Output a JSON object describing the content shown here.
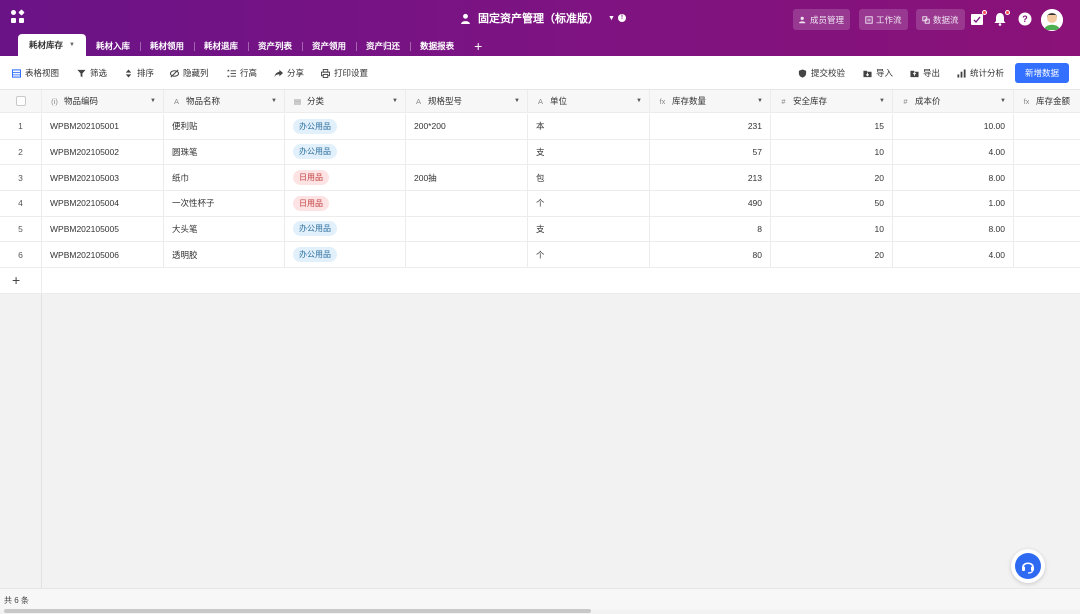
{
  "header": {
    "title": "固定资产管理（标准版）",
    "buttons": {
      "members": "成员管理",
      "workflow": "工作流",
      "dataflow": "数据流"
    },
    "help_glyph": "?"
  },
  "tabs": [
    {
      "label": "耗材库存",
      "active": true
    },
    {
      "label": "耗材入库"
    },
    {
      "label": "耗材领用"
    },
    {
      "label": "耗材退库"
    },
    {
      "label": "资产列表"
    },
    {
      "label": "资产领用"
    },
    {
      "label": "资产归还"
    },
    {
      "label": "数据报表"
    }
  ],
  "tab_add": "+",
  "toolbar": {
    "table_view": "表格视图",
    "filter": "筛选",
    "sort": "排序",
    "hide_cols": "隐藏列",
    "row_height": "行高",
    "share": "分享",
    "print": "打印设置",
    "submit_check": "提交校验",
    "import": "导入",
    "export": "导出",
    "stats": "统计分析",
    "new_data": "新增数据"
  },
  "columns": [
    {
      "label": "物品编码",
      "icon": "(i)"
    },
    {
      "label": "物品名称",
      "icon": "A"
    },
    {
      "label": "分类",
      "icon": "▤"
    },
    {
      "label": "规格型号",
      "icon": "A"
    },
    {
      "label": "单位",
      "icon": "A"
    },
    {
      "label": "库存数量",
      "icon": "fx"
    },
    {
      "label": "安全库存",
      "icon": "#"
    },
    {
      "label": "成本价",
      "icon": "#"
    },
    {
      "label": "库存金额",
      "icon": "fx"
    }
  ],
  "rows": [
    {
      "n": "1",
      "code": "WPBM202105001",
      "name": "便利贴",
      "cat": "办公用品",
      "cat_type": "office",
      "spec": "200*200",
      "unit": "本",
      "qty": "231",
      "safe": "15",
      "cost": "10.00"
    },
    {
      "n": "2",
      "code": "WPBM202105002",
      "name": "圆珠笔",
      "cat": "办公用品",
      "cat_type": "office",
      "spec": "",
      "unit": "支",
      "qty": "57",
      "safe": "10",
      "cost": "4.00"
    },
    {
      "n": "3",
      "code": "WPBM202105003",
      "name": "纸巾",
      "cat": "日用品",
      "cat_type": "daily",
      "spec": "200抽",
      "unit": "包",
      "qty": "213",
      "safe": "20",
      "cost": "8.00"
    },
    {
      "n": "4",
      "code": "WPBM202105004",
      "name": "一次性杯子",
      "cat": "日用品",
      "cat_type": "daily",
      "spec": "",
      "unit": "个",
      "qty": "490",
      "safe": "50",
      "cost": "1.00"
    },
    {
      "n": "5",
      "code": "WPBM202105005",
      "name": "大头笔",
      "cat": "办公用品",
      "cat_type": "office",
      "spec": "",
      "unit": "支",
      "qty": "8",
      "safe": "10",
      "cost": "8.00"
    },
    {
      "n": "6",
      "code": "WPBM202105006",
      "name": "透明胶",
      "cat": "办公用品",
      "cat_type": "office",
      "spec": "",
      "unit": "个",
      "qty": "80",
      "safe": "20",
      "cost": "4.00"
    }
  ],
  "add_row": "+",
  "status": "共 6 条",
  "colors": {
    "header_start": "#6a1387",
    "header_end": "#8a1278",
    "primary": "#3370ff",
    "tag_office_bg": "#e1f0fb",
    "tag_daily_bg": "#fde3e3"
  }
}
